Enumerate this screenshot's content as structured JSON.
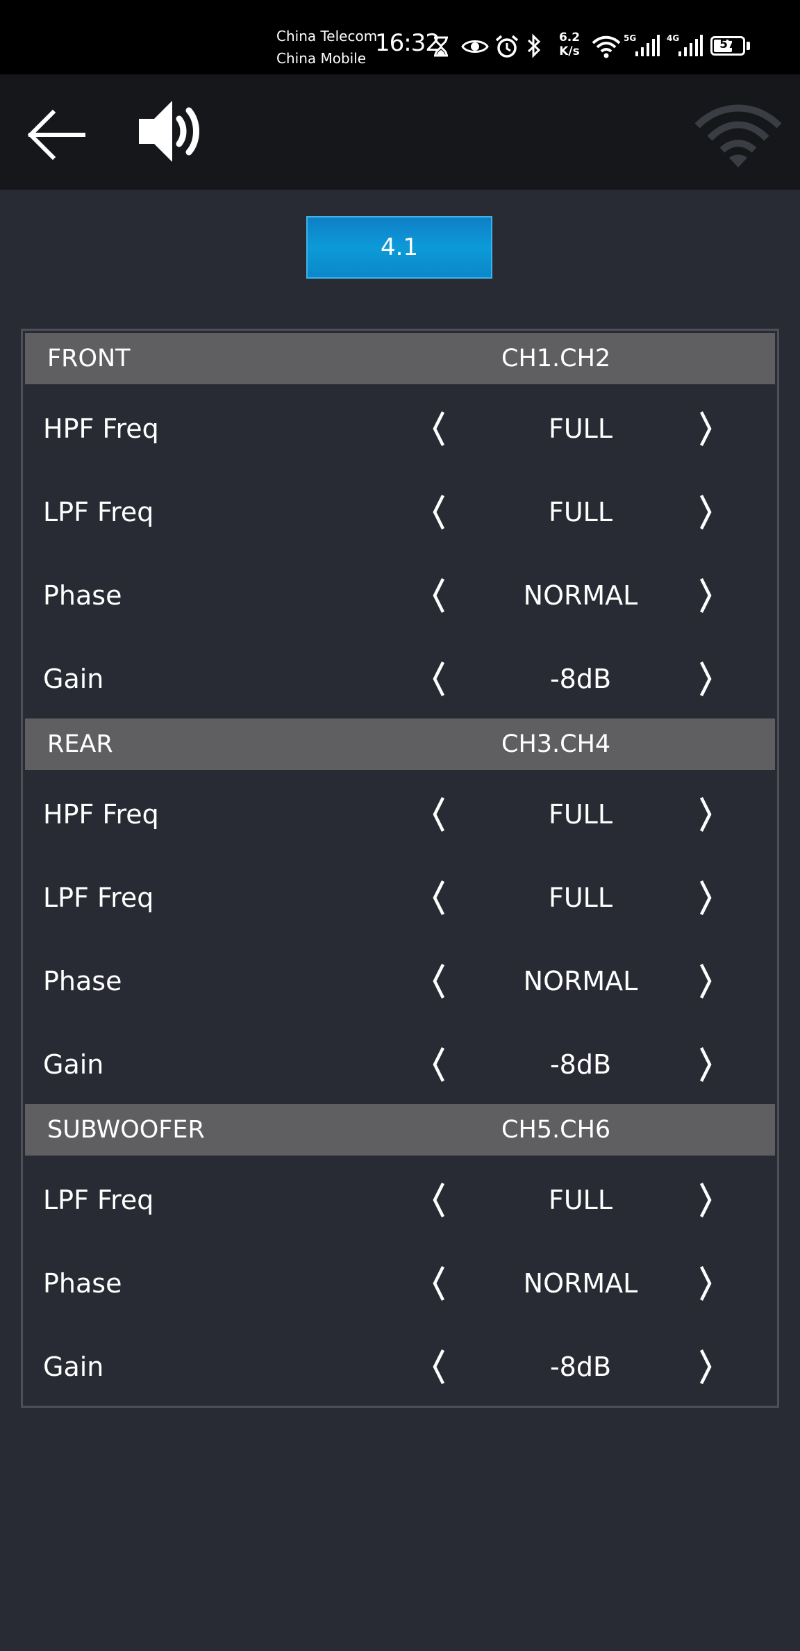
{
  "status_bar": {
    "carrier1": "China Telecom",
    "carrier2": "China Mobile",
    "time": "16:32",
    "net_speed_value": "6.2",
    "net_speed_unit": "K/s",
    "sim1_tag": "5G",
    "sim2_tag": "4G",
    "battery_level": "57",
    "icons": [
      "hourglass-icon",
      "eye-icon",
      "alarm-icon",
      "bluetooth-icon",
      "wifi-icon",
      "signal-icon",
      "signal-icon",
      "battery-icon"
    ]
  },
  "header": {
    "back_icon": "arrow-left-icon",
    "speaker_icon": "speaker-volume-icon",
    "wifi_icon": "wifi-disconnected-icon"
  },
  "mode": {
    "label": "4.1"
  },
  "sections": [
    {
      "title": "FRONT",
      "channels": "CH1.CH2",
      "rows": [
        {
          "label": "HPF Freq",
          "value": "FULL"
        },
        {
          "label": "LPF Freq",
          "value": "FULL"
        },
        {
          "label": "Phase",
          "value": "NORMAL"
        },
        {
          "label": "Gain",
          "value": "-8dB"
        }
      ]
    },
    {
      "title": "REAR",
      "channels": "CH3.CH4",
      "rows": [
        {
          "label": "HPF Freq",
          "value": "FULL"
        },
        {
          "label": "LPF Freq",
          "value": "FULL"
        },
        {
          "label": "Phase",
          "value": "NORMAL"
        },
        {
          "label": "Gain",
          "value": "-8dB"
        }
      ]
    },
    {
      "title": "SUBWOOFER",
      "channels": "CH5.CH6",
      "rows": [
        {
          "label": "LPF Freq",
          "value": "FULL"
        },
        {
          "label": "Phase",
          "value": "NORMAL"
        },
        {
          "label": "Gain",
          "value": "-8dB"
        }
      ]
    }
  ],
  "colors": {
    "background": "#282b33",
    "header_bg": "#16171b",
    "section_bg": "#5f5f61",
    "accent": "#0d9ad8"
  }
}
